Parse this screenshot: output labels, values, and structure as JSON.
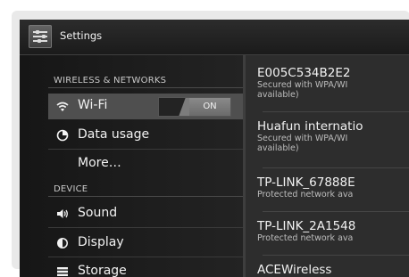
{
  "actionbar": {
    "title": "Settings",
    "app_icon": "settings-sliders-icon"
  },
  "left": {
    "sections": [
      {
        "header": "WIRELESS & NETWORKS"
      },
      {
        "header": "DEVICE"
      }
    ],
    "items": [
      {
        "label": "Wi-Fi",
        "icon": "wifi-icon",
        "toggle": "ON",
        "selected": true
      },
      {
        "label": "Data usage",
        "icon": "data-usage-icon"
      },
      {
        "label": "More…"
      },
      {
        "label": "Sound",
        "icon": "speaker-icon"
      },
      {
        "label": "Display",
        "icon": "display-icon"
      },
      {
        "label": "Storage",
        "icon": "storage-icon"
      }
    ]
  },
  "networks": [
    {
      "ssid": "E005C534B2E2",
      "status_line1": "Secured with WPA/WI",
      "status_line2": "available)"
    },
    {
      "ssid": "Huafun internatio",
      "status_line1": "Secured with WPA/WI",
      "status_line2": "available)"
    },
    {
      "ssid": "TP-LINK_67888E",
      "status_line1": "Protected network ava"
    },
    {
      "ssid": "TP-LINK_2A1548",
      "status_line1": "Protected network ava"
    },
    {
      "ssid": "ACEWireless"
    }
  ],
  "colors": {
    "background": "#1a1a1a",
    "selected_row": "#4f4f4f",
    "text": "#f2f2f2",
    "subtext": "#bdbdbd"
  }
}
